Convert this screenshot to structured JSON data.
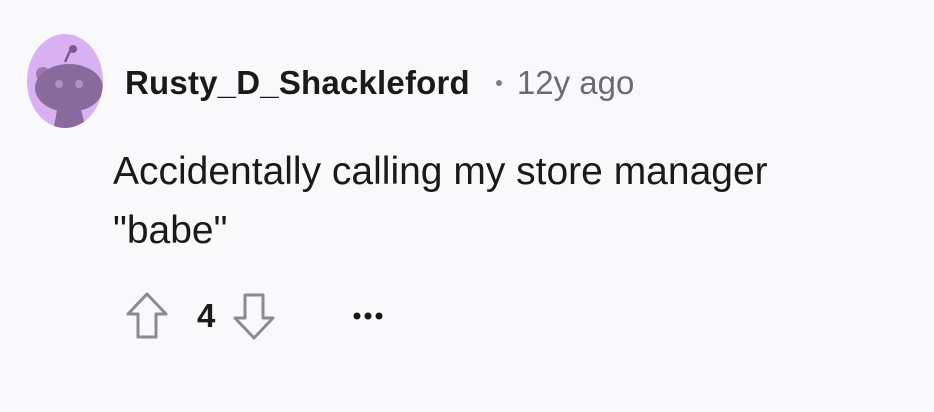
{
  "comment": {
    "author": "Rusty_D_Shackleford",
    "separator": "•",
    "age": "12y ago",
    "body_line1": "Accidentally calling my store manager",
    "body_line2": "\"babe\"",
    "score": "4",
    "avatar_icon": "snoo-avatar-icon",
    "avatar_color": "#d9b0f2"
  },
  "actions": {
    "upvote_icon": "upvote-arrow-icon",
    "downvote_icon": "downvote-arrow-icon",
    "more_icon": "more-options-icon"
  }
}
